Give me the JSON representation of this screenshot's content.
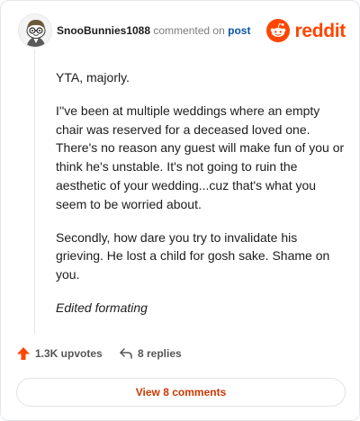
{
  "header": {
    "username": "SnooBunnies1088",
    "action_text": "commented on",
    "target_link": "post",
    "brand_name": "reddit",
    "brand_color": "#ff4500",
    "avatar_icon": "snoo-avatar-icon"
  },
  "comment": {
    "paragraphs": [
      "YTA, majorly.",
      "I''ve been at multiple weddings where an empty chair was reserved for a deceased loved one. There's no reason any guest will make fun of you or think he's unstable. It's not going to ruin the aesthetic of your wedding...cuz that's what you seem to be worried about.",
      "Secondly, how dare you try to invalidate his grieving. He lost a child for gosh sake. Shame on you.",
      "Edited formating"
    ]
  },
  "actions": {
    "upvotes_label": "1.3K upvotes",
    "upvote_icon": "upvote-arrow-icon",
    "replies_label": "8 replies",
    "reply_icon": "reply-arrow-icon"
  },
  "footer": {
    "view_comments_label": "View 8 comments"
  }
}
